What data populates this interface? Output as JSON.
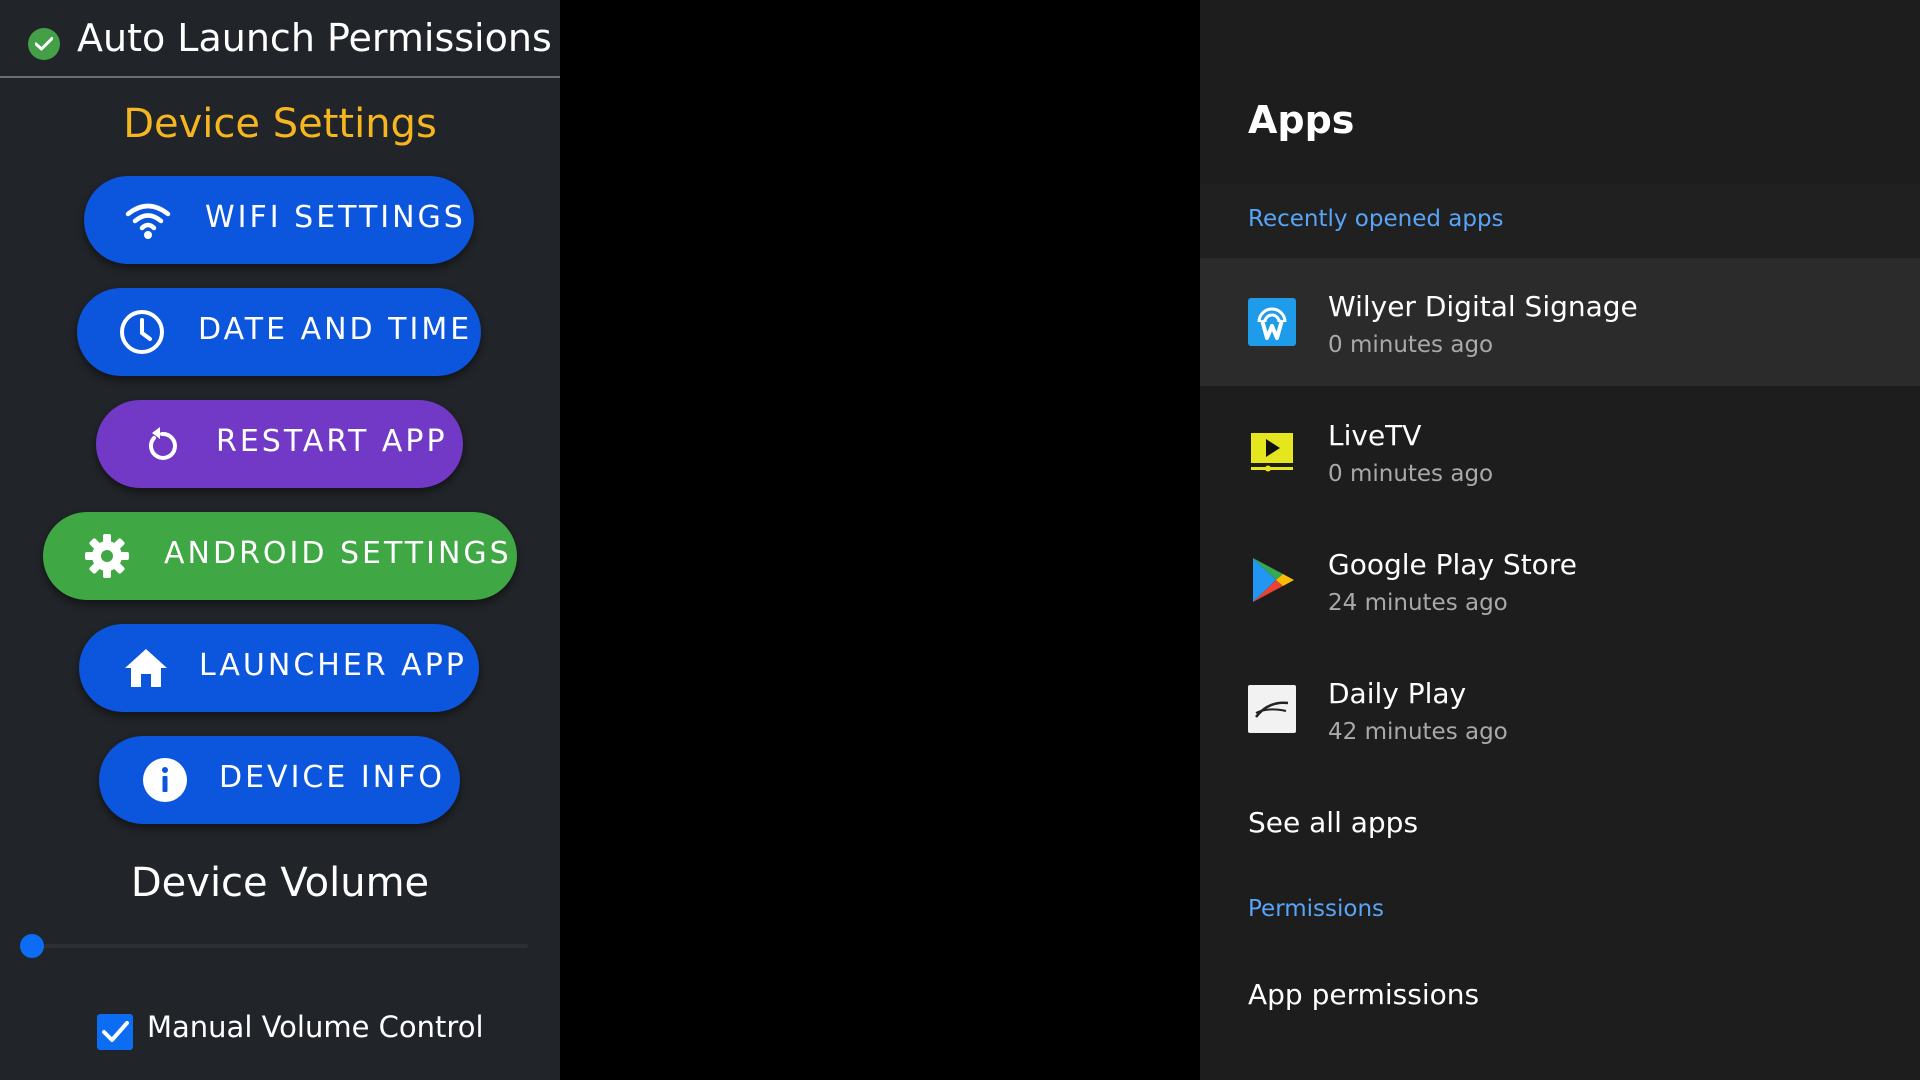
{
  "left_panel": {
    "header_title": "Auto Launch Permissions",
    "section_title": "Device Settings",
    "buttons": [
      {
        "label": "WIFI SETTINGS",
        "icon": "wifi-icon",
        "color": "#0c55dd"
      },
      {
        "label": "DATE AND TIME",
        "icon": "clock-icon",
        "color": "#0c55dd"
      },
      {
        "label": "RESTART APP",
        "icon": "restart-icon",
        "color": "#7239c7"
      },
      {
        "label": "ANDROID SETTINGS",
        "icon": "gear-icon",
        "color": "#40a745"
      },
      {
        "label": "LAUNCHER APP",
        "icon": "home-icon",
        "color": "#0c55dd"
      },
      {
        "label": "DEVICE INFO",
        "icon": "info-icon",
        "color": "#0c55dd"
      }
    ],
    "volume_title": "Device Volume",
    "volume_level": 0,
    "manual_volume_label": "Manual Volume Control",
    "manual_volume_checked": true
  },
  "right_panel": {
    "title": "Apps",
    "recent_header": "Recently opened apps",
    "apps": [
      {
        "name": "Wilyer Digital Signage",
        "time": "0 minutes ago",
        "icon": "wilyer-icon",
        "selected": true
      },
      {
        "name": "LiveTV",
        "time": "0 minutes ago",
        "icon": "livetv-icon",
        "selected": false
      },
      {
        "name": "Google Play Store",
        "time": "24 minutes ago",
        "icon": "play-store-icon",
        "selected": false
      },
      {
        "name": "Daily Play",
        "time": "42 minutes ago",
        "icon": "daily-play-icon",
        "selected": false
      }
    ],
    "see_all": "See all apps",
    "permissions_header": "Permissions",
    "app_permissions": "App permissions"
  },
  "colors": {
    "accent_yellow": "#f6b620",
    "link_blue": "#58a4f7",
    "check_green": "#43a047"
  }
}
